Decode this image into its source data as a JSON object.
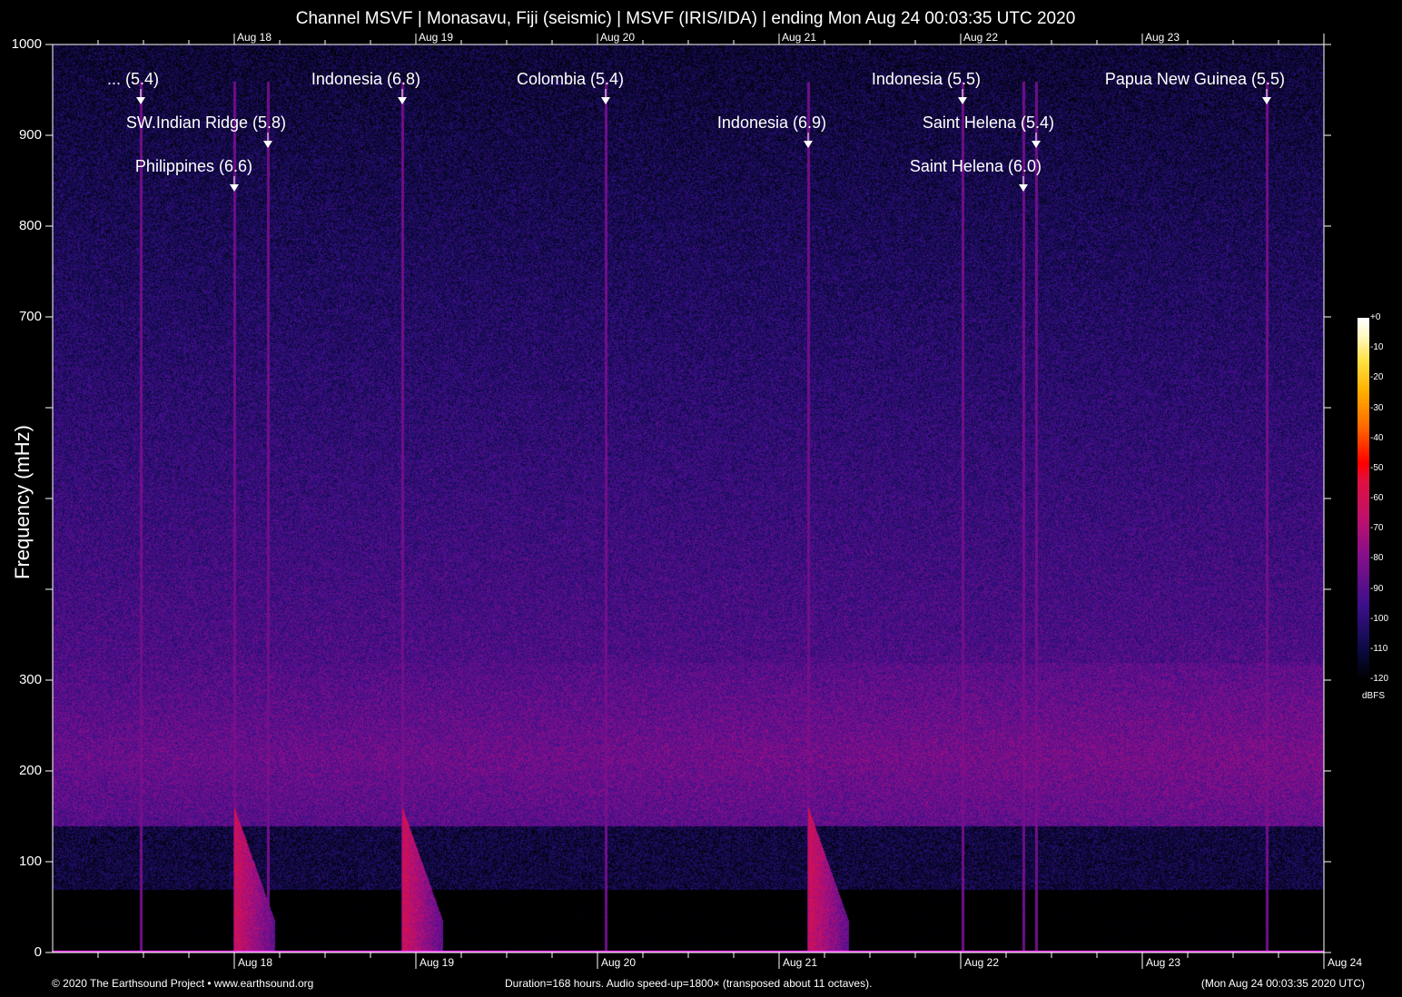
{
  "title": "Channel MSVF | Monasavu, Fiji (seismic) | MSVF (IRIS/IDA) | ending Mon Aug 24 00:03:35 UTC 2020",
  "chart_data": {
    "type": "heatmap",
    "title": "Channel MSVF | Monasavu, Fiji (seismic) | MSVF (IRIS/IDA) | ending Mon Aug 24 00:03:35 UTC 2020",
    "ylabel": "Frequency (mHz)",
    "ylim": [
      0,
      1000
    ],
    "y_ticks": [
      0,
      100,
      200,
      300,
      400,
      500,
      600,
      700,
      800,
      900,
      1000
    ],
    "y_tick_labels": [
      "0",
      "100",
      "200",
      "300",
      "",
      "",
      "",
      "700",
      "800",
      "900",
      "1000"
    ],
    "x_range_hours": [
      0,
      168
    ],
    "x_tick_labels": [
      {
        "label": "Aug 18",
        "hour": 24
      },
      {
        "label": "Aug 19",
        "hour": 48
      },
      {
        "label": "Aug 20",
        "hour": 72
      },
      {
        "label": "Aug 21",
        "hour": 96
      },
      {
        "label": "Aug 22",
        "hour": 120
      },
      {
        "label": "Aug 23",
        "hour": 144
      },
      {
        "label": "Aug 24",
        "hour": 168
      }
    ],
    "colorbar": {
      "unit": "dBFS",
      "range": [
        -120,
        0
      ],
      "tick_labels": [
        "+0",
        "-10",
        "-20",
        "-30",
        "-40",
        "-50",
        "-60",
        "-70",
        "-80",
        "-90",
        "-100",
        "-110",
        "-120"
      ],
      "colors": [
        "#000000",
        "#0a0a40",
        "#3a0f8a",
        "#8a0f8a",
        "#c0106a",
        "#e01040",
        "#ff0000",
        "#ff6a00",
        "#ffb000",
        "#ffe040",
        "#fff8c0",
        "#ffffff"
      ]
    },
    "background_noise": {
      "description_bands_mHz": [
        [
          0,
          70,
          -125
        ],
        [
          70,
          140,
          -108
        ],
        [
          140,
          300,
          -85
        ],
        [
          300,
          1000,
          -100
        ]
      ]
    },
    "events": [
      {
        "label": "... (5.4)",
        "hour": 11.6
      },
      {
        "label": "SW.Indian Ridge (5.8)",
        "hour": 28.4
      },
      {
        "label": "Philippines (6.6)",
        "hour": 24.0
      },
      {
        "label": "Indonesia (6.8)",
        "hour": 46.2
      },
      {
        "label": "Colombia (5.4)",
        "hour": 73.1
      },
      {
        "label": "Indonesia (6.9)",
        "hour": 99.8
      },
      {
        "label": "Indonesia (5.5)",
        "hour": 120.2
      },
      {
        "label": "Saint Helena (5.4)",
        "hour": 130.0
      },
      {
        "label": "Saint Helena (6.0)",
        "hour": 128.3
      },
      {
        "label": "Papua New Guinea (5.5)",
        "hour": 160.4
      }
    ]
  },
  "footer": {
    "left": "© 2020 The Earthsound Project • www.earthsound.org",
    "middle": "Duration=168 hours. Audio speed-up=1800× (transposed about 11 octaves).",
    "right": "(Mon Aug 24 00:03:35 2020 UTC)"
  }
}
